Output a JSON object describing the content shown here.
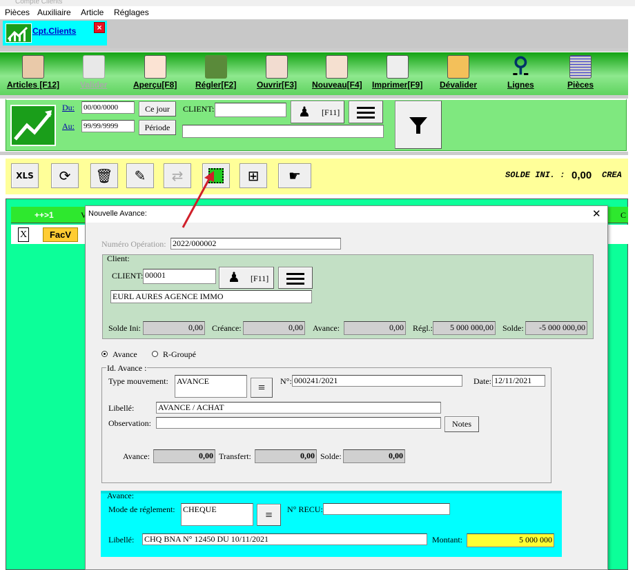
{
  "window_title": "Compte Clients",
  "menu": [
    "Pièces",
    "Auxiliaire",
    "Article",
    "Réglages"
  ],
  "tab": {
    "label": "Cpt.Clients",
    "close": "×"
  },
  "toolbar": [
    {
      "label": "Articles [F12]",
      "icon": "articles-icon",
      "enabled": true
    },
    {
      "label": "Valider",
      "icon": "valider-icon",
      "enabled": false
    },
    {
      "label": "Aperçu[F8]",
      "icon": "apercu-icon",
      "enabled": true
    },
    {
      "label": "Régler[F2]",
      "icon": "money-icon",
      "enabled": true
    },
    {
      "label": "Ouvrir[F3]",
      "icon": "ouvrir-icon",
      "enabled": true
    },
    {
      "label": "Nouveau[F4]",
      "icon": "nouveau-icon",
      "enabled": true
    },
    {
      "label": "Imprimer[F9]",
      "icon": "printer-icon",
      "enabled": true
    },
    {
      "label": "Dévalider",
      "icon": "devalider-icon",
      "enabled": true
    },
    {
      "label": "Lignes",
      "icon": "search-icon",
      "enabled": true
    },
    {
      "label": "Pièces",
      "icon": "grid-icon",
      "enabled": true
    }
  ],
  "filter": {
    "du_label": "Du:",
    "du_value": "00/00/0000",
    "au_label": "Au:",
    "au_value": "99/99/9999",
    "cejour": "Ce jour",
    "periode": "Période",
    "client_label": "CLIENT:",
    "client_value": "",
    "client_name": "",
    "f11": "[F11]"
  },
  "solde": {
    "label": "SOLDE INI. :",
    "value": "0,00",
    "next": "CREA"
  },
  "grid": {
    "col1": "++>1",
    "col2": "V",
    "col_last": "C",
    "row_x": "X",
    "row_badge": "FacV"
  },
  "dialog": {
    "title": "Nouvelle Avance:",
    "close": "✕",
    "num_op_label": "Numéro Opération:",
    "num_op_value": "2022/000002",
    "client_group": "Client:",
    "client_label": "CLIENT:",
    "client_value": "00001",
    "f11": "[F11]",
    "client_name": "EURL AURES AGENCE IMMO",
    "solde_ini_label": "Solde Ini:",
    "solde_ini": "0,00",
    "creance_label": "Créance:",
    "creance": "0,00",
    "avance_label": "Avance:",
    "avance": "0,00",
    "regl_label": "Régl.:",
    "regl": "5 000 000,00",
    "solde_label": "Solde:",
    "solde": "-5 000 000,00",
    "radio_avance": "Avance",
    "radio_rgroupe": "R-Groupé",
    "id_group": "Id. Avance :",
    "type_label": "Type mouvement:",
    "type_value": "AVANCE",
    "no_label": "N°:",
    "no_value": "000241/2021",
    "date_label": "Date:",
    "date_value": "12/11/2021",
    "libelle_label": "Libellé:",
    "libelle_value": "AVANCE / ACHAT",
    "obs_label": "Observation:",
    "obs_value": "",
    "notes": "Notes",
    "av_label": "Avance:",
    "av_value": "0,00",
    "transfert_label": "Transfert:",
    "transfert_value": "0,00",
    "solde2_label": "Solde:",
    "solde2_value": "0,00",
    "avance_group": "Avance:",
    "mode_label": "Mode de réglement:",
    "mode_value": "CHEQUE",
    "recu_label": "N° RECU:",
    "recu_value": "",
    "libelle2_label": "Libellé:",
    "libelle2_value": "CHQ BNA  N° 12450  DU 10/11/2021",
    "montant_label": "Montant:",
    "montant_value": "5 000 000"
  },
  "colors": {
    "green": "#13a313",
    "cyan": "#00ffff",
    "yellow": "#ffff99",
    "grid": "#0cff99",
    "arrow": "#d0202a"
  }
}
